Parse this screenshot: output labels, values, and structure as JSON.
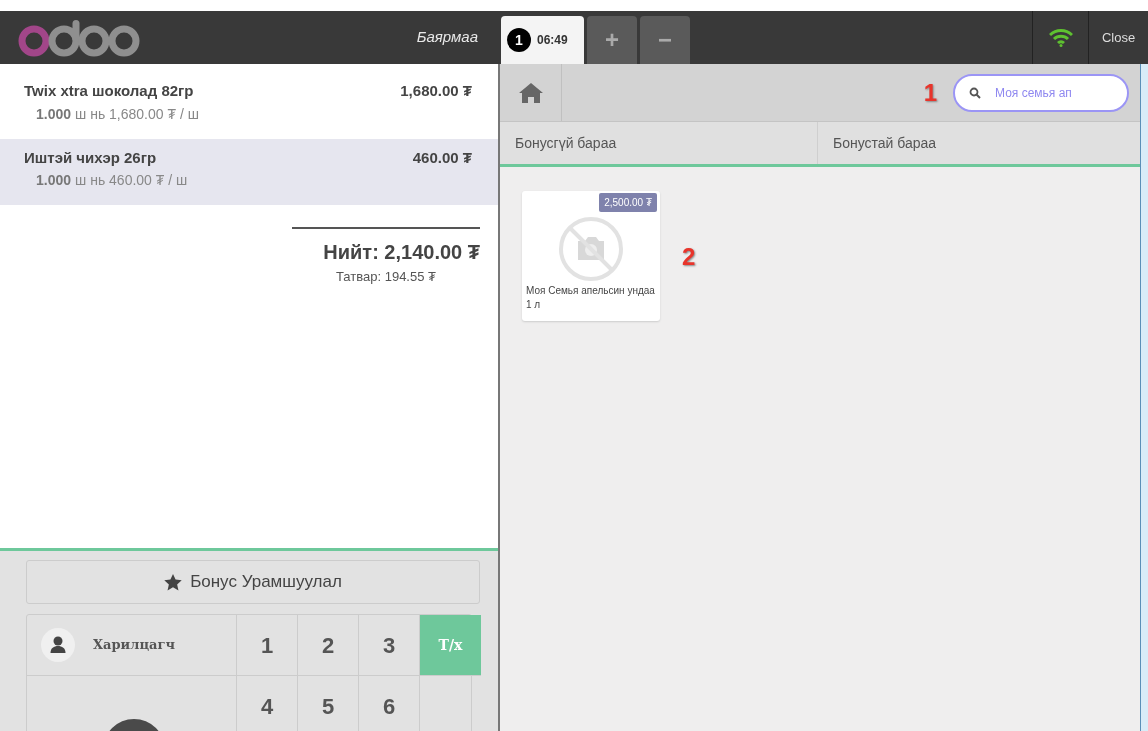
{
  "header": {
    "user": "Баярмаа",
    "order_tabs": [
      {
        "badge": "1",
        "time": "06:49",
        "selected": true
      }
    ],
    "add_label": "+",
    "remove_label": "−",
    "close_label": "Close",
    "online": true
  },
  "order_lines": [
    {
      "name": "Twix xtra шоколад 82гр",
      "price": "1,680.00 ₮",
      "qty": "1.000",
      "detail": "ш нь 1,680.00 ₮ / ш",
      "selected": false
    },
    {
      "name": "Иштэй чихэр 26гр",
      "price": "460.00 ₮",
      "qty": "1.000",
      "detail": "ш нь 460.00 ₮ / ш",
      "selected": true
    }
  ],
  "summary": {
    "total": "Нийт: 2,140.00 ₮",
    "tax": "Татвар: 194.55 ₮"
  },
  "bonus_button": "Бонус Урамшуулал",
  "numpad": {
    "customer": "Харилцагч",
    "rows": [
      [
        "1",
        "2",
        "3"
      ],
      [
        "4",
        "5",
        "6"
      ]
    ],
    "modes": [
      {
        "label": "T/x",
        "selected": true
      }
    ]
  },
  "search": {
    "value": "Моя семья ап"
  },
  "categories": [
    {
      "label": "Бонусгүй бараа"
    },
    {
      "label": "Бонустай бараа"
    }
  ],
  "products": [
    {
      "name": "Моя Семья апельсин ундаа 1 л",
      "price": "2,500.00 ₮"
    }
  ],
  "annotations": [
    "1",
    "2"
  ]
}
